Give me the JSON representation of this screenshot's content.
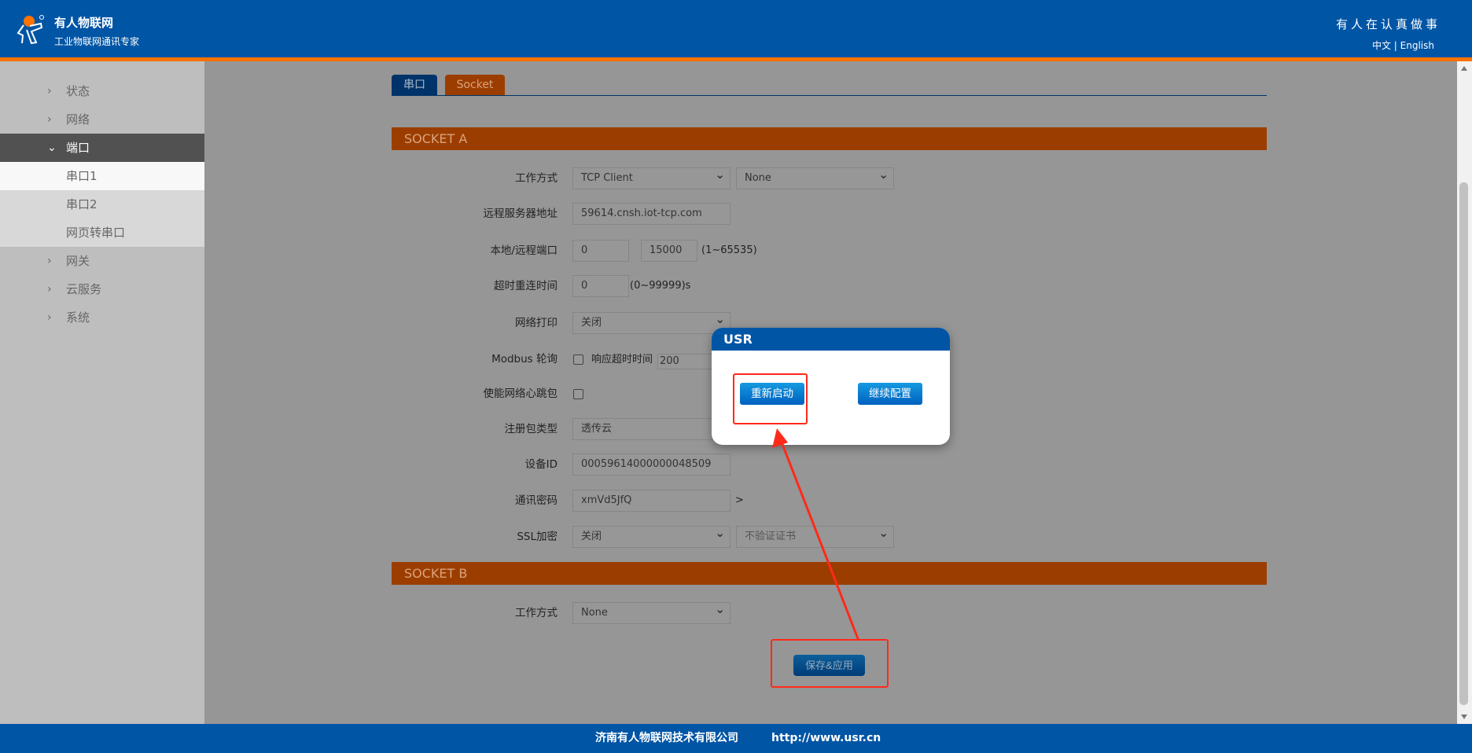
{
  "header": {
    "brand": "有人物联网",
    "tagline": "工业物联网通讯专家",
    "slogan": "有人在认真做事",
    "lang_zh": "中文",
    "lang_sep": "|",
    "lang_en": "English"
  },
  "sidebar": {
    "items": [
      {
        "label": "状态",
        "chevron": "›"
      },
      {
        "label": "网络",
        "chevron": "›"
      },
      {
        "label": "端口",
        "chevron": "⌄"
      },
      {
        "label": "串口1"
      },
      {
        "label": "串口2"
      },
      {
        "label": "网页转串口"
      },
      {
        "label": "网关",
        "chevron": "›"
      },
      {
        "label": "云服务",
        "chevron": "›"
      },
      {
        "label": "系统",
        "chevron": "›"
      }
    ]
  },
  "tabs": [
    {
      "label": "串口"
    },
    {
      "label": "Socket"
    }
  ],
  "socket_a": {
    "title": "SOCKET A",
    "work_mode": {
      "label": "工作方式",
      "value": "TCP Client",
      "sub_value": "None"
    },
    "server": {
      "label": "远程服务器地址",
      "value": "59614.cnsh.iot-tcp.com"
    },
    "ports": {
      "label": "本地/远程端口",
      "local": "0",
      "remote": "15000",
      "hint": "(1~65535)"
    },
    "reconnect": {
      "label": "超时重连时间",
      "value": "0",
      "hint": "(0~99999)s"
    },
    "net_print": {
      "label": "网络打印",
      "value": "关闭"
    },
    "modbus": {
      "label": "Modbus 轮询",
      "timeout_label": "响应超时时间",
      "timeout": "200"
    },
    "heartbeat": {
      "label": "使能网络心跳包"
    },
    "reg_type": {
      "label": "注册包类型",
      "value": "透传云"
    },
    "device_id": {
      "label": "设备ID",
      "value": "00059614000000048509"
    },
    "password": {
      "label": "通讯密码",
      "value": "xmVd5JfQ",
      "suffix": ">"
    },
    "ssl": {
      "label": "SSL加密",
      "value": "关闭",
      "cert": "不验证证书"
    }
  },
  "socket_b": {
    "title": "SOCKET B",
    "work_mode": {
      "label": "工作方式",
      "value": "None"
    }
  },
  "save_label": "保存&应用",
  "dialog": {
    "title": "USR",
    "restart": "重新启动",
    "continue": "继续配置"
  },
  "footer": {
    "company": "济南有人物联网技术有限公司",
    "url": "http://www.usr.cn"
  },
  "colors": {
    "header": "#0055a5",
    "accent": "#ff7200",
    "section": "#9c3d00",
    "annotation": "#ff2a1a"
  }
}
